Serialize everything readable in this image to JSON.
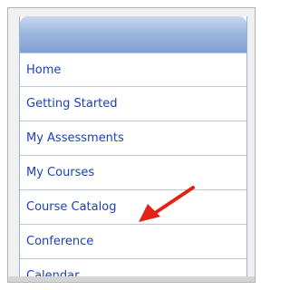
{
  "nav": {
    "items": [
      {
        "label": "Home"
      },
      {
        "label": "Getting Started"
      },
      {
        "label": "My Assessments"
      },
      {
        "label": "My Courses"
      },
      {
        "label": "Course Catalog"
      },
      {
        "label": "Conference"
      },
      {
        "label": "Calendar"
      }
    ]
  },
  "annotation": {
    "icon": "red-arrow-icon",
    "color": "#e32318"
  }
}
